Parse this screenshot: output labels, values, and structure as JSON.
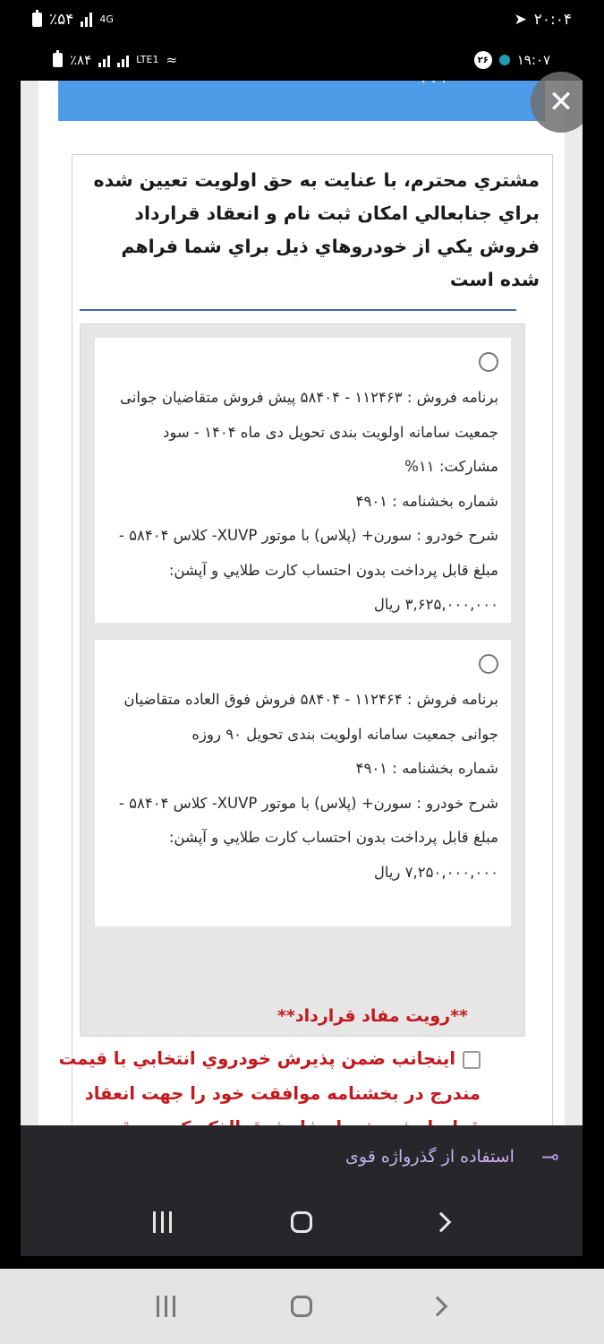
{
  "outer_status": {
    "battery": "٪۵۴",
    "network": "4G",
    "time": "۲۰:۰۴"
  },
  "inner_status": {
    "battery": "٪۸۴",
    "network": "LTE1",
    "badge": "۲۶",
    "time": "۱۹:۰۷"
  },
  "page": {
    "heading": "مشتري محترم، با عنايت به حق اولويت تعيين شده براي جنابعالي امكان ثبت نام و انعقاد قرارداد فروش يكي از خودروهاي ذيل براي شما فراهم شده است",
    "options": [
      {
        "program": "برنامه فروش : ۱۱۲۴۶۳ - ۵۸۴۰۴ پیش فروش متقاضیان جوانی جمعیت سامانه اولویت بندی تحویل دی ماه ۱۴۰۴ - سود مشارکت: ۱۱%",
        "circular": "شماره بخشنامه : ۴۹۰۱",
        "desc": "شرح خودرو : سورن+ (پلاس) با موتور XUVP- کلاس ۵۸۴۰۴ - مبلغ قابل پرداخت بدون احتساب کارت طلايي و آپشن: ۳,۶۲۵,۰۰۰,۰۰۰ ریال"
      },
      {
        "program": "برنامه فروش : ۱۱۲۴۶۴ - ۵۸۴۰۴ فروش فوق العاده متقاضیان جوانی جمعیت سامانه اولویت بندی تحویل ۹۰ روزه",
        "circular": "شماره بخشنامه : ۴۹۰۱",
        "desc": "شرح خودرو : سورن+ (پلاس) با موتور XUVP- کلاس ۵۸۴۰۴ - مبلغ قابل پرداخت بدون احتساب کارت طلايي و آپشن: ۷,۲۵۰,۰۰۰,۰۰۰ ریال"
      }
    ],
    "contract_title": "**رويت مفاد قرارداد**",
    "agree_text": "اينجانب ضمن پذيرش خودروي انتخابي با قيمت مندرج در بخشنامه موافقت خود را جهت انعقاد قرارداد فروش با مفاد فوق الذكر كه به دقت مطالعه نموده ام اعلام مي دارم"
  },
  "suggestion": {
    "text": "استفاده از گذرواژه قوی"
  },
  "colors": {
    "accent_blue": "#4e9be8",
    "alert_red": "#c4181d",
    "suggest_text": "#c4b2ef"
  }
}
